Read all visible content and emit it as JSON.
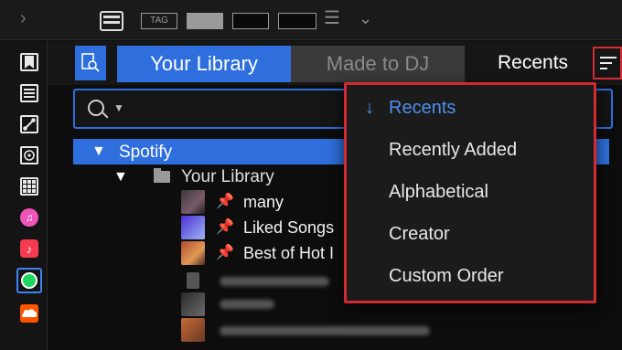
{
  "toolbar": {
    "tag_label": "TAG"
  },
  "left_strip": {
    "icons": [
      "bookmark-icon",
      "list-icon",
      "connect-icon",
      "sampler-icon",
      "grid-icon",
      "apple-music-icon",
      "music-icon",
      "spotify-icon",
      "soundcloud-icon"
    ]
  },
  "header": {
    "tabs": [
      {
        "label": "Your Library",
        "active": true
      },
      {
        "label": "Made to DJ",
        "active": false
      }
    ],
    "sort_label": "Recents"
  },
  "tree": {
    "root": "Spotify",
    "folder": "Your Library",
    "playlists": [
      {
        "label": "many"
      },
      {
        "label": "Liked Songs"
      },
      {
        "label": "Best of Hot I"
      }
    ]
  },
  "sort_menu": {
    "selected_marker": "↓",
    "items": [
      {
        "label": "Recents",
        "selected": true
      },
      {
        "label": "Recently Added",
        "selected": false
      },
      {
        "label": "Alphabetical",
        "selected": false
      },
      {
        "label": "Creator",
        "selected": false
      },
      {
        "label": "Custom Order",
        "selected": false
      }
    ]
  },
  "colors": {
    "accent": "#2f6fdd",
    "highlight": "#d12a31",
    "selected_text": "#4f8ff0"
  }
}
